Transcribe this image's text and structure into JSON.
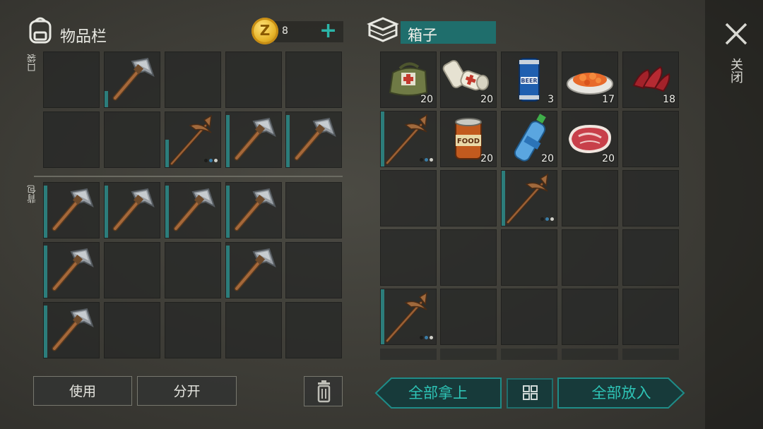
{
  "inventory": {
    "title": "物品栏",
    "pocket_label": "口袋",
    "backpack_label": "背包",
    "currency": {
      "count": "8"
    }
  },
  "container": {
    "title": "箱子"
  },
  "close": {
    "label": "关闭"
  },
  "actions": {
    "use_label": "使用",
    "split_label": "分开",
    "take_all_label": "全部拿上",
    "put_all_label": "全部放入"
  },
  "colors": {
    "accent": "#2ec4b6",
    "teal_dark": "#1f6e6c",
    "durability": "#2c7d7b"
  },
  "icons": {
    "backpack": "backpack-icon",
    "coin": "coin-icon",
    "chest": "chest-icon",
    "close": "close-icon",
    "trash": "trash-icon",
    "grid": "grid-icon"
  },
  "items": {
    "box": {
      "medkit": {
        "count": "20"
      },
      "bandage": {
        "count": "20"
      },
      "beer": {
        "count": "3",
        "text": "BEER"
      },
      "carrots": {
        "count": "17"
      },
      "bacon": {
        "count": "18"
      },
      "canned_food": {
        "count": "20",
        "text": "FOOD"
      },
      "water": {
        "count": "20"
      },
      "steak": {
        "count": "20"
      }
    }
  },
  "pockets": [
    {
      "item": "empty"
    },
    {
      "item": "stone-pickaxe",
      "durability": 0.3
    },
    {
      "item": "empty"
    },
    {
      "item": "empty"
    },
    {
      "item": "empty"
    },
    {
      "item": "empty"
    },
    {
      "item": "empty"
    },
    {
      "item": "iron-pickaxe",
      "durability": 0.5
    },
    {
      "item": "stone-pickaxe",
      "durability": 0.95
    },
    {
      "item": "stone-pickaxe",
      "durability": 0.95
    }
  ],
  "backpack": [
    {
      "item": "stone-pickaxe",
      "durability": 0.95
    },
    {
      "item": "stone-pickaxe",
      "durability": 0.95
    },
    {
      "item": "stone-pickaxe",
      "durability": 0.95
    },
    {
      "item": "stone-pickaxe",
      "durability": 0.95
    },
    {
      "item": "empty"
    },
    {
      "item": "stone-pickaxe",
      "durability": 0.95
    },
    {
      "item": "empty"
    },
    {
      "item": "empty"
    },
    {
      "item": "stone-pickaxe",
      "durability": 0.95
    },
    {
      "item": "empty"
    },
    {
      "item": "stone-pickaxe",
      "durability": 0.95
    },
    {
      "item": "empty"
    },
    {
      "item": "empty"
    },
    {
      "item": "empty"
    },
    {
      "item": "empty"
    }
  ]
}
